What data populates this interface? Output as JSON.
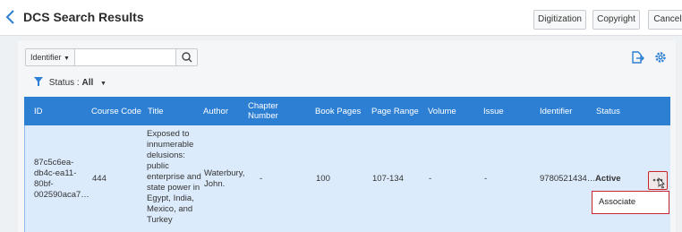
{
  "header": {
    "title": "DCS Search Results",
    "buttons": {
      "digitization": "Digitization",
      "copyright": "Copyright",
      "cancel": "Cancel"
    }
  },
  "toolbar": {
    "search_type": "Identifier",
    "search_value": "",
    "icons": {
      "export": "export-icon",
      "settings": "gear-icon"
    }
  },
  "filter": {
    "label": "Status :",
    "value": "All"
  },
  "table": {
    "columns": [
      "ID",
      "Course Code",
      "Title",
      "Author",
      "Chapter Number",
      "Book Pages",
      "Page Range",
      "Volume",
      "Issue",
      "Identifier",
      "Status"
    ],
    "rows": [
      {
        "id": "87c5c6ea-db4c-ea11-80bf-002590aca7…",
        "course_code": "444",
        "title": "Exposed to innumerable delusions: public enterprise and state power in Egypt, India, Mexico, and Turkey",
        "author": "Waterbury, John.",
        "chapter_number": "-",
        "book_pages": "100",
        "page_range": "107-134",
        "volume": "-",
        "issue": "-",
        "identifier": "9780521434…",
        "status": "Active"
      }
    ]
  },
  "row_menu": {
    "associate": "Associate"
  },
  "colors": {
    "accent": "#2c7fd3",
    "row_selected": "#dcebfb",
    "highlight": "#c9252c"
  }
}
